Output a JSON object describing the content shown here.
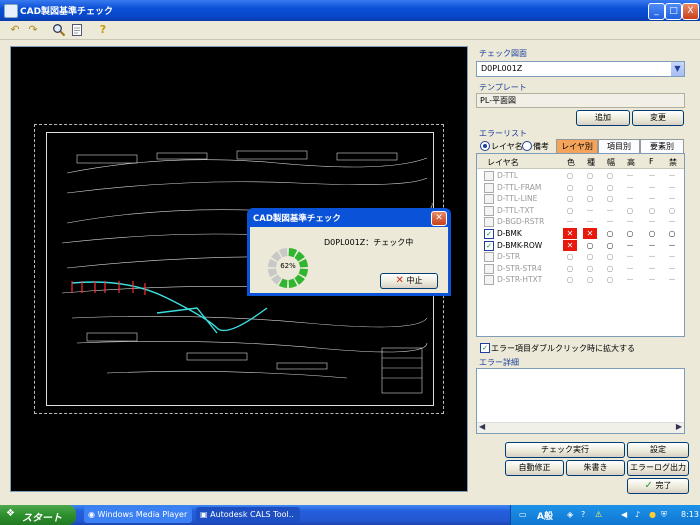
{
  "window": {
    "title": "CAD製図基準チェック",
    "minimize": "_",
    "maximize": "□",
    "close": "X"
  },
  "toolbar": {
    "icons": [
      "undo-icon",
      "redo-icon",
      "search-icon",
      "document-icon",
      "help-icon"
    ],
    "help_glyph": "?"
  },
  "panel": {
    "check_drawing_label": "チェック図面",
    "drawing_value": "D0PL001Z",
    "template_label": "テンプレート",
    "template_value": "PL-平面図",
    "add_button": "追加",
    "change_button": "変更",
    "error_list_label": "エラーリスト",
    "radio_layer_name": "レイヤ名",
    "radio_note": "備考",
    "tabs": [
      {
        "label": "レイヤ別",
        "active": true
      },
      {
        "label": "項目別",
        "active": false
      },
      {
        "label": "要素別",
        "active": false
      }
    ],
    "columns": [
      "レイヤ名",
      "色",
      "種",
      "幅",
      "高",
      "F",
      "禁"
    ],
    "rows": [
      {
        "name": "D-TTL",
        "checked": false,
        "enabled": false,
        "cells": [
          "○",
          "○",
          "○",
          "－",
          "－",
          "－"
        ]
      },
      {
        "name": "D-TTL-FRAM",
        "checked": false,
        "enabled": false,
        "cells": [
          "○",
          "○",
          "○",
          "－",
          "－",
          "－"
        ]
      },
      {
        "name": "D-TTL-LINE",
        "checked": false,
        "enabled": false,
        "cells": [
          "○",
          "○",
          "○",
          "－",
          "－",
          "－"
        ]
      },
      {
        "name": "D-TTL-TXT",
        "checked": false,
        "enabled": false,
        "cells": [
          "○",
          "－",
          "－",
          "○",
          "○",
          "○"
        ]
      },
      {
        "name": "D-BGD-RSTR",
        "checked": false,
        "enabled": false,
        "cells": [
          "－",
          "－",
          "－",
          "－",
          "－",
          "－"
        ]
      },
      {
        "name": "D-BMK",
        "checked": true,
        "enabled": true,
        "cells": [
          "✕",
          "✕",
          "○",
          "○",
          "○",
          "○"
        ],
        "errors": [
          0,
          1
        ]
      },
      {
        "name": "D-BMK-ROW",
        "checked": true,
        "enabled": true,
        "cells": [
          "✕",
          "○",
          "○",
          "－",
          "－",
          "－"
        ],
        "errors": [
          0
        ]
      },
      {
        "name": "D-STR",
        "checked": false,
        "enabled": false,
        "cells": [
          "○",
          "○",
          "○",
          "－",
          "－",
          "－"
        ]
      },
      {
        "name": "D-STR-STR4",
        "checked": false,
        "enabled": false,
        "cells": [
          "○",
          "○",
          "○",
          "－",
          "－",
          "－"
        ]
      },
      {
        "name": "D-STR-HTXT",
        "checked": false,
        "enabled": false,
        "cells": [
          "○",
          "○",
          "○",
          "－",
          "－",
          "－"
        ]
      }
    ],
    "enlarge_checkbox_label": "エラー項目ダブルクリック時に拡大する",
    "error_detail_label": "エラー詳細",
    "check_run_button": "チェック実行",
    "settings_button": "設定",
    "auto_fix_button": "自動修正",
    "red_write_button": "朱書き",
    "error_log_button": "エラーログ出力",
    "done_button": "完了"
  },
  "dialog": {
    "title": "CAD製図基準チェック",
    "status": "D0PL001Z：チェック中",
    "progress_percent": 62,
    "progress_label": "62%",
    "cancel_button": "中止"
  },
  "taskbar": {
    "start": "スタート",
    "tasks": [
      "Windows Media Player",
      "Autodesk CALS Tool.."
    ],
    "ime": "A般",
    "clock": "8:13"
  },
  "colors": {
    "titlebar": "#0a4fd6",
    "error": "#e8180c",
    "active_tab": "#f5a35a",
    "cad_line": "#d8d8d8",
    "cad_cyan": "#3de0e0",
    "cad_red": "#ff3030",
    "progress": "#2fb52f"
  }
}
